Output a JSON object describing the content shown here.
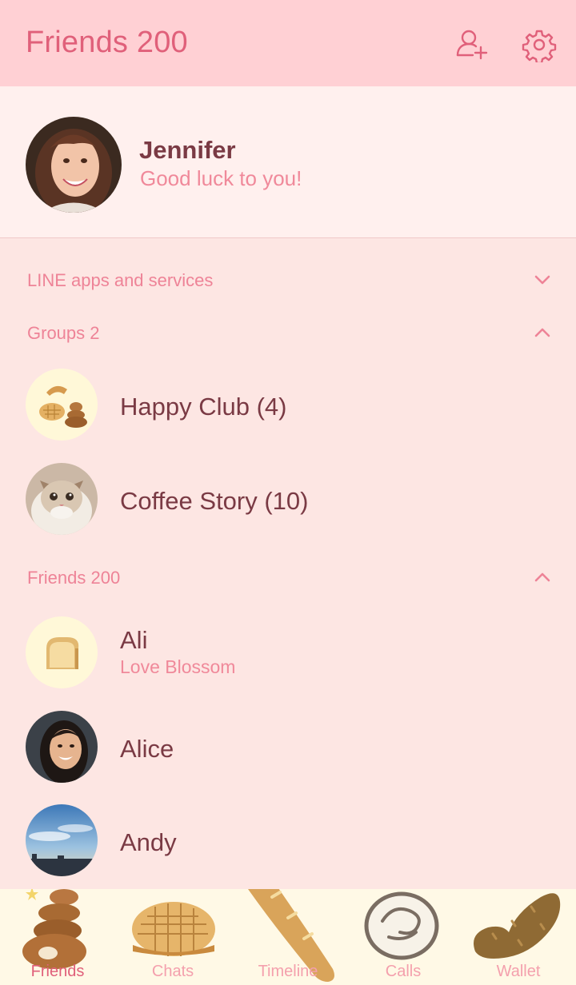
{
  "header": {
    "title": "Friends 200",
    "icons": [
      "add-friend-icon",
      "gear-icon"
    ],
    "bg_color": "#ffd0d4",
    "title_color": "#e0607a"
  },
  "profile": {
    "name": "Jennifer",
    "status": "Good luck to you!"
  },
  "sections": {
    "services": {
      "label": "LINE apps and services",
      "state": "collapsed"
    },
    "groups": {
      "label": "Groups 2",
      "state": "expanded"
    },
    "friends": {
      "label": "Friends 200",
      "state": "expanded"
    }
  },
  "groups": [
    {
      "name": "Happy Club (4)",
      "avatar": "bread-stack-avatar"
    },
    {
      "name": "Coffee Story (10)",
      "avatar": "cat-photo-avatar"
    }
  ],
  "friends": [
    {
      "name": "Ali",
      "status": "Love Blossom",
      "avatar": "toast-avatar"
    },
    {
      "name": "Alice",
      "status": "",
      "avatar": "woman-photo-avatar"
    },
    {
      "name": "Andy",
      "status": "",
      "avatar": "sky-photo-avatar"
    }
  ],
  "tabs": [
    {
      "label": "Friends",
      "icon": "bread-stack-icon",
      "active": true
    },
    {
      "label": "Chats",
      "icon": "melon-pan-icon",
      "active": false
    },
    {
      "label": "Timeline",
      "icon": "baguette-icon",
      "active": false
    },
    {
      "label": "Calls",
      "icon": "bun-icon",
      "active": false
    },
    {
      "label": "Wallet",
      "icon": "twist-bread-icon",
      "active": false
    }
  ],
  "colors": {
    "background": "#fde6e3",
    "accent": "#e0607a",
    "name_text": "#7a3a44",
    "status_text": "#f0899a",
    "tabbar_bg": "#fff9e6"
  }
}
